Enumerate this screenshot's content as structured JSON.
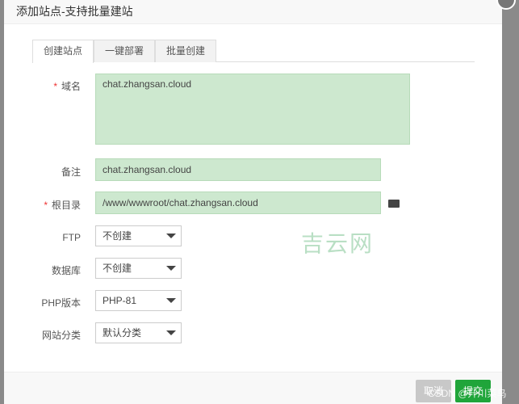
{
  "dialog": {
    "title": "添加站点-支持批量建站"
  },
  "tabs": [
    {
      "label": "创建站点",
      "active": true
    },
    {
      "label": "一键部署"
    },
    {
      "label": "批量创建"
    }
  ],
  "form": {
    "domain": {
      "label": "域名",
      "required": true,
      "value": "chat.zhangsan.cloud"
    },
    "remark": {
      "label": "备注",
      "value": "chat.zhangsan.cloud"
    },
    "root": {
      "label": "根目录",
      "required": true,
      "value": "/www/wwwroot/chat.zhangsan.cloud",
      "icon": "folder-open-icon"
    },
    "ftp": {
      "label": "FTP",
      "value": "不创建"
    },
    "database": {
      "label": "数据库",
      "value": "不创建"
    },
    "php": {
      "label": "PHP版本",
      "value": "PHP-81"
    },
    "category": {
      "label": "网站分类",
      "value": "默认分类"
    }
  },
  "footer": {
    "cancel": "取消",
    "submit": "提交"
  },
  "watermarks": {
    "center": "吉云网",
    "corner": "CSDN @升川菜鸟"
  },
  "colors": {
    "accent": "#20a53a",
    "field_bg": "#cde8cf"
  }
}
